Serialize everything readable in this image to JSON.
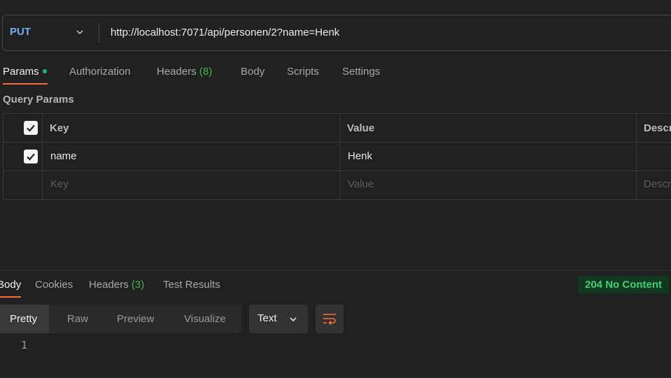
{
  "request": {
    "method": "PUT",
    "url": "http://localhost:7071/api/personen/2?name=Henk"
  },
  "request_tabs": [
    {
      "label": "Params",
      "active": true,
      "indicator": "green-dot"
    },
    {
      "label": "Authorization"
    },
    {
      "label": "Headers",
      "count": "(8)"
    },
    {
      "label": "Body"
    },
    {
      "label": "Scripts"
    },
    {
      "label": "Settings"
    }
  ],
  "query_params": {
    "title": "Query Params",
    "columns": [
      "Key",
      "Value",
      "Descr"
    ],
    "rows": [
      {
        "checked": true,
        "key": "name",
        "value": "Henk",
        "description": ""
      }
    ],
    "placeholders": {
      "key": "Key",
      "value": "Value",
      "description": "Descr"
    }
  },
  "response": {
    "tabs": [
      {
        "label": "Body",
        "active": true
      },
      {
        "label": "Cookies"
      },
      {
        "label": "Headers",
        "count": "(3)"
      },
      {
        "label": "Test Results"
      }
    ],
    "status": "204 No Content",
    "view_options": [
      "Pretty",
      "Raw",
      "Preview",
      "Visualize"
    ],
    "active_view": "Pretty",
    "format": "Text",
    "line_numbers": [
      "1"
    ]
  },
  "colors": {
    "accent": "#ff6c37",
    "method": "#74aef6",
    "success": "#3fd07a",
    "count": "#3fb950"
  },
  "icons": [
    "chevron-down-icon",
    "checkmark-icon",
    "word-wrap-icon"
  ]
}
